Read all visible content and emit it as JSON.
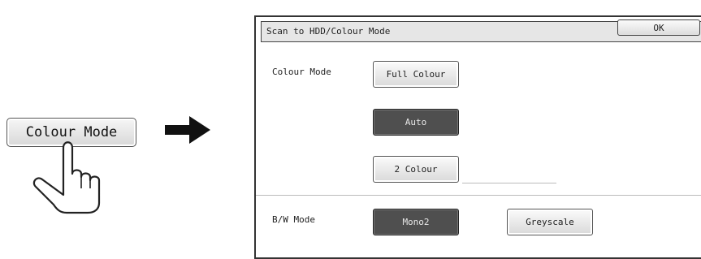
{
  "key": {
    "label": "Colour Mode"
  },
  "screen": {
    "title": "Scan to HDD/Colour Mode",
    "ok_label": "OK",
    "colour_mode": {
      "label": "Colour Mode",
      "options": {
        "full": "Full Colour",
        "auto": "Auto",
        "two": "2 Colour"
      },
      "selected": "Auto"
    },
    "bw_mode": {
      "label": "B/W Mode",
      "options": {
        "mono2": "Mono2",
        "greyscale": "Greyscale"
      },
      "selected": "Mono2"
    }
  }
}
